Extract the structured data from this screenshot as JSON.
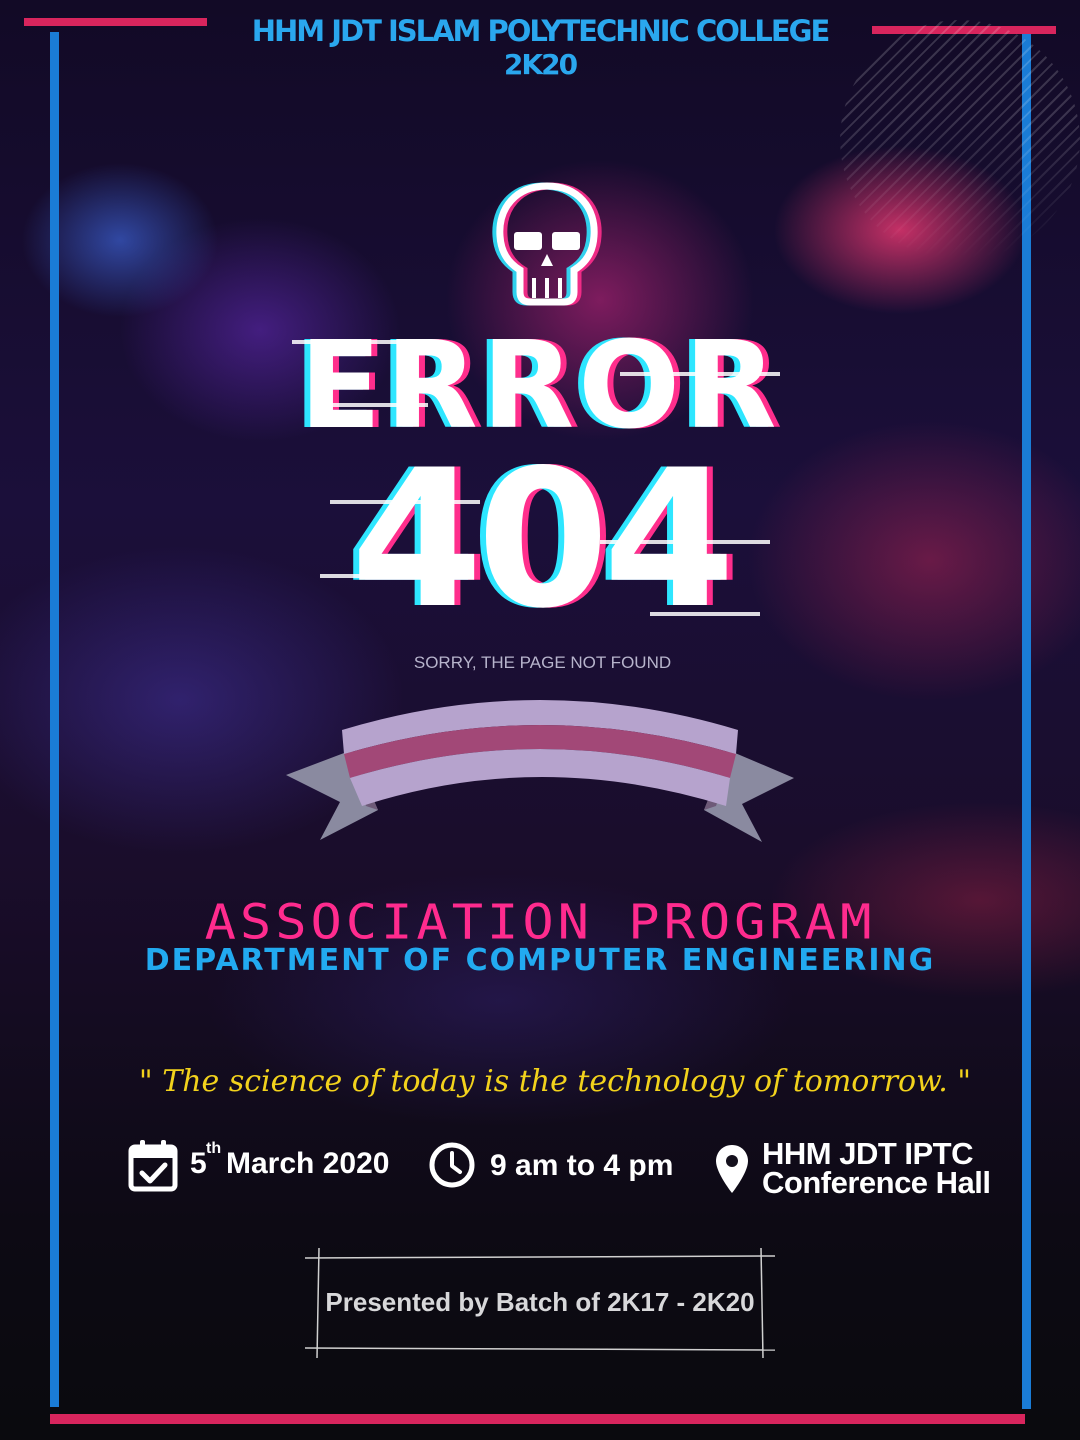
{
  "header": {
    "college_name": "HHM JDT ISLAM POLYTECHNIC COLLEGE",
    "year": "2K20"
  },
  "hero": {
    "icon": "skull-icon",
    "error_word": "ERROR",
    "error_code": "404",
    "sorry_text": "SORRY, THE PAGE NOT FOUND"
  },
  "ribbon": {
    "colors": [
      "#b6a3cd",
      "#a24877",
      "#6e5a78",
      "#8a8aa0"
    ]
  },
  "event": {
    "title": "ASSOCIATION PROGRAM",
    "department": "DEPARTMENT OF COMPUTER ENGINEERING",
    "quote": "\" The science of today is the technology of tomorrow. \""
  },
  "details": {
    "date_day": "5",
    "date_suffix": "th",
    "date_month": "March 2020",
    "time": "9 am to 4 pm",
    "venue_line1": "HHM JDT IPTC",
    "venue_line2": "Conference Hall",
    "icons": [
      "calendar-check-icon",
      "clock-icon",
      "location-pin-icon"
    ]
  },
  "footer": {
    "presented_by": "Presented by Batch of 2K17 - 2K20"
  },
  "colors": {
    "frame_pink": "#d8255d",
    "frame_blue": "#1a7cd6",
    "title_pink": "#ff2b8e",
    "department_blue": "#22aaf0",
    "quote_yellow": "#f2d21c",
    "glitch_cyan": "#2ee6ff",
    "glitch_magenta": "#ff2e8c"
  }
}
